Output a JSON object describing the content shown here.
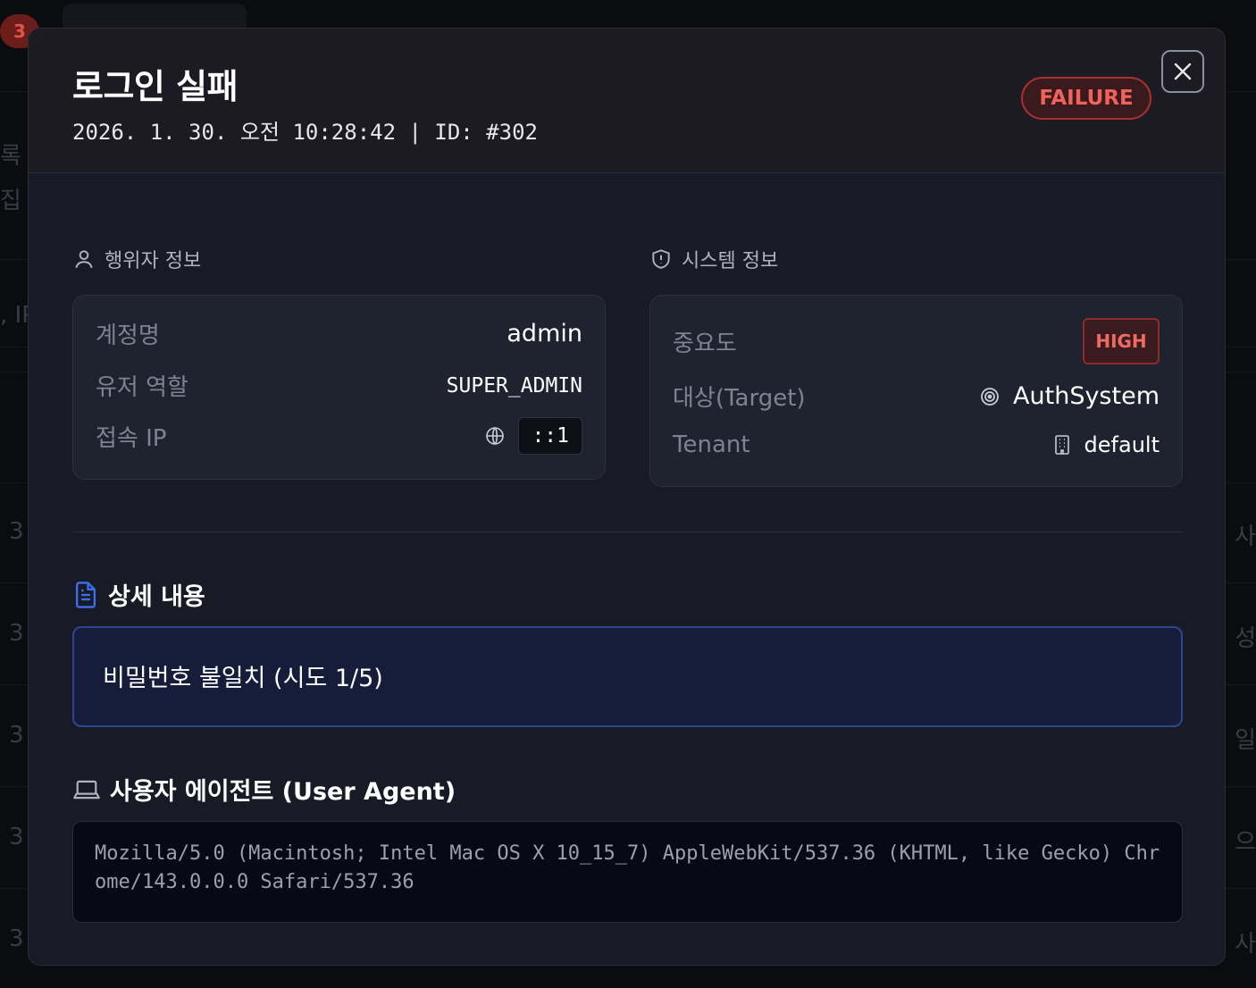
{
  "background": {
    "badge_count": "3",
    "fragments_left": [
      "록",
      "집",
      ", IP"
    ],
    "fragments_right": [
      "사",
      "성",
      "일",
      "으",
      "사"
    ],
    "fragments_rowid": [
      "3",
      "3",
      "3",
      "3",
      "3"
    ]
  },
  "modal": {
    "title": "로그인 실패",
    "meta": "2026. 1. 30. 오전 10:28:42 | ID: #302",
    "status": "FAILURE",
    "colors": {
      "failure": "#f0625c",
      "accent": "#3b6ff0"
    }
  },
  "actor": {
    "label": "행위자 정보",
    "rows": [
      {
        "key": "계정명",
        "value": "admin"
      },
      {
        "key": "유저 역할",
        "value": "SUPER_ADMIN"
      },
      {
        "key": "접속 IP",
        "value": "::1"
      }
    ]
  },
  "system": {
    "label": "시스템 정보",
    "severity_label": "중요도",
    "severity": "HIGH",
    "target_label": "대상(Target)",
    "target": "AuthSystem",
    "tenant_label": "Tenant",
    "tenant": "default"
  },
  "detail": {
    "label": "상세 내용",
    "text": "비밀번호 불일치 (시도 1/5)"
  },
  "user_agent": {
    "label": "사용자 에이전트 (User Agent)",
    "text": "Mozilla/5.0 (Macintosh; Intel Mac OS X 10_15_7) AppleWebKit/537.36 (KHTML, like Gecko) Chrome/143.0.0.0 Safari/537.36"
  },
  "icons": {
    "actor": "user-icon",
    "system": "shield-alert-icon",
    "ip": "globe-icon",
    "target": "target-icon",
    "tenant": "building-icon",
    "detail": "file-text-icon",
    "user_agent": "laptop-icon",
    "close": "close-icon"
  }
}
